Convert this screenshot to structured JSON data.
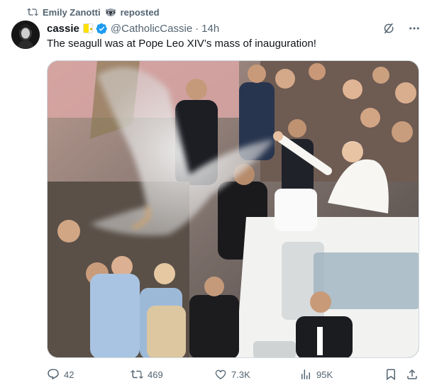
{
  "repost": {
    "user": "Emily Zanotti",
    "label": "reposted"
  },
  "author": {
    "display_name": "cassie",
    "handle": "@CatholicCassie",
    "separator": "·",
    "time": "14h"
  },
  "tweet": {
    "text": "The seagull was at Pope Leo XIV’s mass of inauguration!"
  },
  "stats": {
    "replies": "42",
    "reposts": "469",
    "likes": "7.3K",
    "views": "95K"
  },
  "colors": {
    "text": "#0f1419",
    "muted": "#536471",
    "verified": "#1d9bf0",
    "border": "#cfd9de"
  },
  "icons": {
    "repost": "repost-icon",
    "verified": "verified-badge-icon",
    "grok": "grok-icon",
    "more": "more-icon",
    "reply": "reply-icon",
    "retweet": "retweet-icon",
    "like": "heart-icon",
    "views": "views-icon",
    "bookmark": "bookmark-icon",
    "share": "share-icon"
  }
}
